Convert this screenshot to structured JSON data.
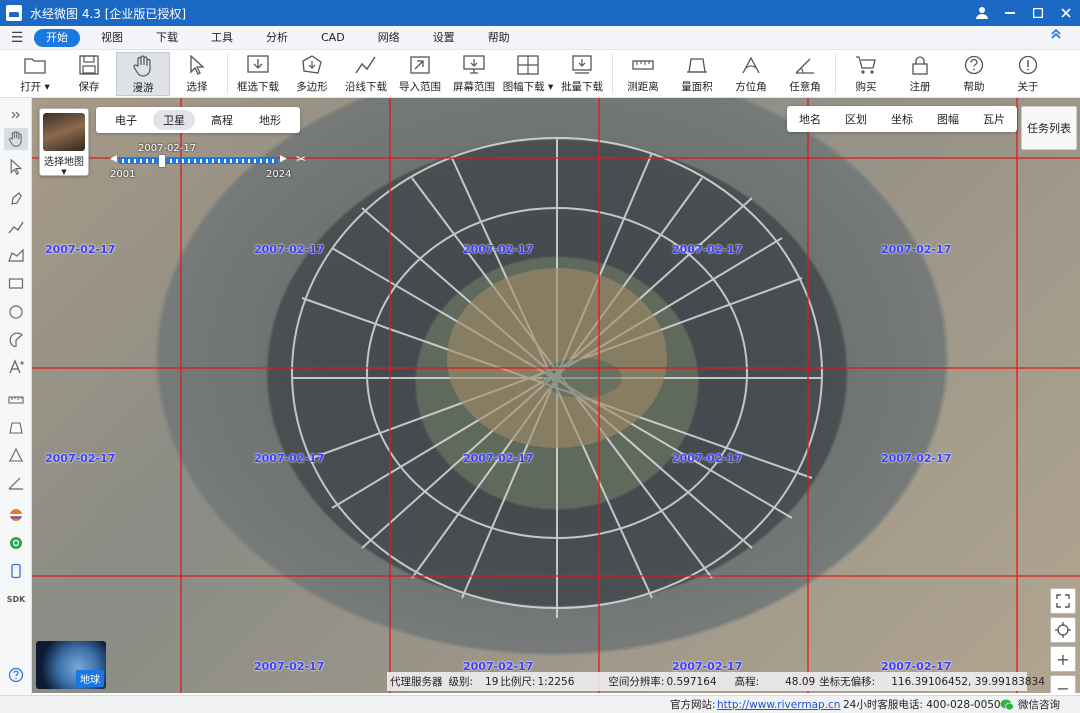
{
  "window": {
    "title": "水经微图 4.3 [企业版已授权]"
  },
  "menu": {
    "items": [
      "开始",
      "视图",
      "下载",
      "工具",
      "分析",
      "CAD",
      "网络",
      "设置",
      "帮助"
    ],
    "active": "开始"
  },
  "toolbar": {
    "items": [
      {
        "label": "打开",
        "icon": "folder-icon"
      },
      {
        "label": "保存",
        "icon": "save-icon"
      },
      {
        "label": "漫游",
        "icon": "hand-icon",
        "active": true
      },
      {
        "label": "选择",
        "icon": "pointer-icon"
      },
      {
        "label": "框选下载",
        "icon": "box-download-icon"
      },
      {
        "label": "多边形",
        "icon": "polygon-icon"
      },
      {
        "label": "沿线下载",
        "icon": "polyline-icon"
      },
      {
        "label": "导入范围",
        "icon": "import-icon"
      },
      {
        "label": "屏幕范围",
        "icon": "screen-icon"
      },
      {
        "label": "图幅下载",
        "icon": "grid-icon"
      },
      {
        "label": "批量下载",
        "icon": "batch-download-icon"
      },
      {
        "label": "测距离",
        "icon": "ruler-icon"
      },
      {
        "label": "量面积",
        "icon": "area-icon"
      },
      {
        "label": "方位角",
        "icon": "azimuth-icon"
      },
      {
        "label": "任意角",
        "icon": "angle-icon"
      },
      {
        "label": "购买",
        "icon": "cart-icon"
      },
      {
        "label": "注册",
        "icon": "lock-icon"
      },
      {
        "label": "帮助",
        "icon": "help-icon"
      },
      {
        "label": "关于",
        "icon": "info-icon"
      }
    ]
  },
  "map": {
    "basemap_label": "选择地图",
    "type_tabs": [
      "电子",
      "卫星",
      "高程",
      "地形"
    ],
    "active_type": "卫星",
    "right_tabs": [
      "地名",
      "区划",
      "坐标",
      "图幅",
      "瓦片"
    ],
    "task_list_label": "任务列表",
    "timeline": {
      "current": "2007-02-17",
      "start": "2001",
      "end": "2024"
    },
    "tile_date": "2007-02-17",
    "globe_label": "地球",
    "info": {
      "server": "代理服务器",
      "level_label": "级别:",
      "level": "19",
      "scale_label": "比例尺:",
      "scale": "1:2256",
      "resolution_label": "空间分辨率:",
      "resolution": "0.597164",
      "elevation_label": "高程:",
      "elevation": "48.09",
      "offset_label": "坐标无偏移:",
      "coords": "116.39106452, 39.99183834"
    }
  },
  "status": {
    "site_label": "官方网站:",
    "site_url": "http://www.rivermap.cn",
    "hotline": "24小时客服电话:  400-028-0050",
    "wechat": "微信咨询"
  },
  "colors": {
    "accent": "#1b78e0",
    "titlebar": "#1b68c5",
    "grid_line": "#e01a1a",
    "date_label": "#3a3cff"
  }
}
